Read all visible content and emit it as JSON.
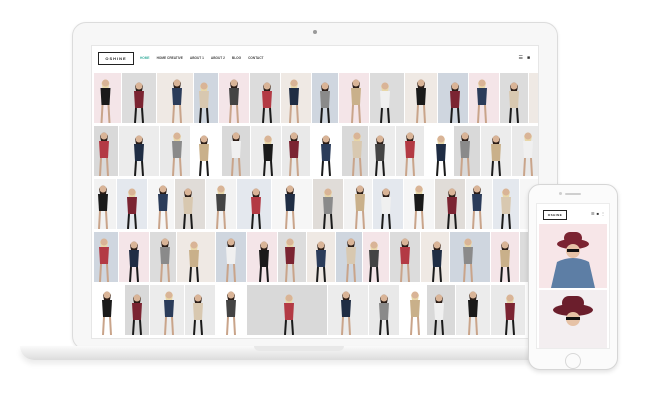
{
  "site": {
    "logo": "OSHINE",
    "nav": [
      "HOME",
      "HOME CREATIVE",
      "ABOUT 1",
      "ABOUT 2",
      "BLOG",
      "CONTACT"
    ],
    "active_nav_index": 0,
    "header_icons": [
      "menu-icon",
      "bag-icon"
    ]
  },
  "phone": {
    "logo": "OSHINE",
    "header_icons": [
      "menu-icon",
      "bag-icon",
      "more-icon"
    ]
  },
  "colors": {
    "accent": "#3fb0a0",
    "background": "#ffffff"
  }
}
